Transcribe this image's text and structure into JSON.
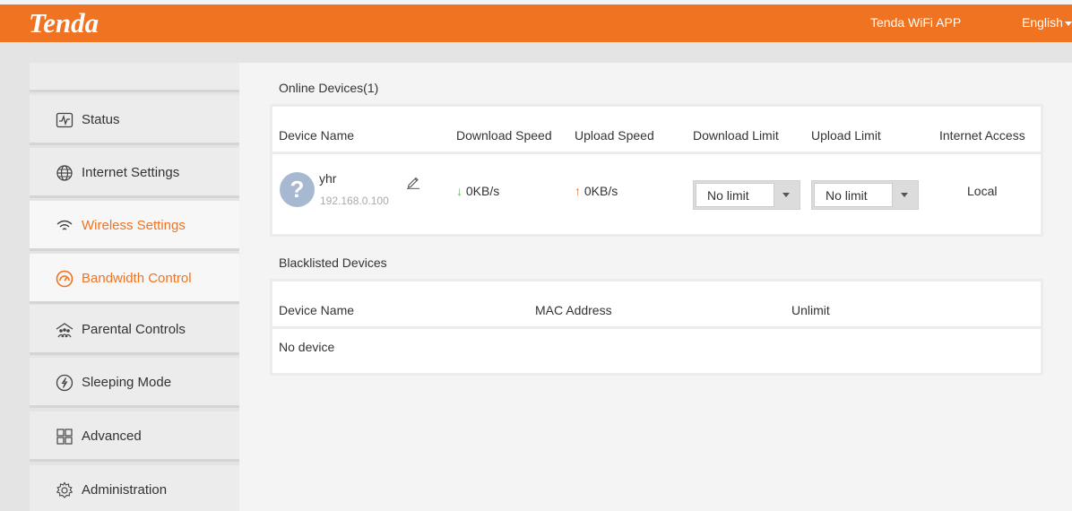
{
  "header": {
    "logo": "Tenda",
    "app_link": "Tenda WiFi APP",
    "language": "English"
  },
  "sidebar": {
    "items": [
      {
        "label": "Status",
        "icon": "status-icon"
      },
      {
        "label": "Internet Settings",
        "icon": "globe-icon"
      },
      {
        "label": "Wireless Settings",
        "icon": "wifi-icon"
      },
      {
        "label": "Bandwidth Control",
        "icon": "speedometer-icon"
      },
      {
        "label": "Parental Controls",
        "icon": "family-icon"
      },
      {
        "label": "Sleeping Mode",
        "icon": "power-icon"
      },
      {
        "label": "Advanced",
        "icon": "grid-icon"
      },
      {
        "label": "Administration",
        "icon": "gear-icon"
      }
    ]
  },
  "online": {
    "title": "Online Devices(1)",
    "columns": [
      "Device Name",
      "Download Speed",
      "Upload Speed",
      "Download Limit",
      "Upload Limit",
      "Internet Access"
    ],
    "rows": [
      {
        "avatar_glyph": "?",
        "name": "yhr",
        "ip": "192.168.0.100",
        "download_arrow": "↓",
        "download_speed": "0KB/s",
        "upload_arrow": "↑",
        "upload_speed": "0KB/s",
        "download_limit": "No limit",
        "upload_limit": "No limit",
        "internet_access": "Local"
      }
    ]
  },
  "blacklist": {
    "title": "Blacklisted Devices",
    "columns": [
      "Device Name",
      "MAC Address",
      "Unlimit"
    ],
    "empty_text": "No device"
  },
  "colors": {
    "brand": "#f07321",
    "download_arrow": "#5cb85c",
    "upload_arrow": "#f07321",
    "avatar": "#a7b9d1"
  }
}
